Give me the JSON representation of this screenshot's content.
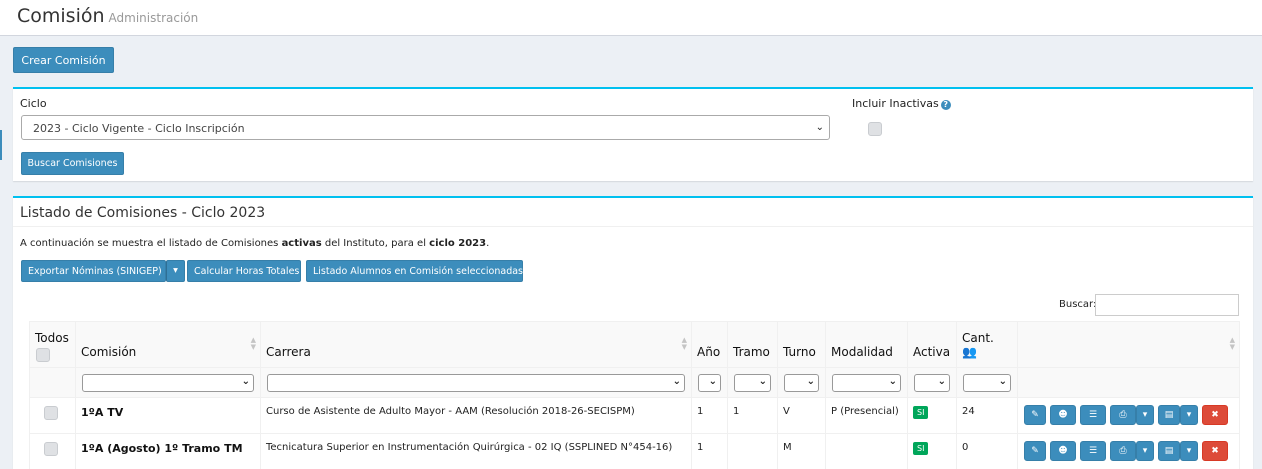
{
  "header": {
    "title": "Comisión",
    "subtitle": "Administración"
  },
  "create_button": "Crear Comisión",
  "filter": {
    "ciclo_label": "Ciclo",
    "ciclo_value": "2023 - Ciclo Vigente - Ciclo Inscripción",
    "inactivas_label": "Incluir Inactivas",
    "help_glyph": "?",
    "buscar_button": "Buscar Comisiones"
  },
  "list": {
    "title": "Listado de Comisiones - Ciclo 2023",
    "intro_pre": "A continuación se muestra el listado de Comisiones ",
    "intro_bold1": "activas",
    "intro_mid": " del Instituto, para el ",
    "intro_bold2": "ciclo 2023",
    "intro_end": ".",
    "buttons": {
      "export": "Exportar Nóminas (SINIGEP)",
      "horas": "Calcular Horas Totales",
      "alumnos": "Listado Alumnos en Comisión seleccionadas"
    },
    "search_label": "Buscar:",
    "columns": {
      "todos": "Todos",
      "comision": "Comisión",
      "carrera": "Carrera",
      "anio": "Año",
      "tramo": "Tramo",
      "turno": "Turno",
      "modalidad": "Modalidad",
      "activa": "Activa",
      "cant": "Cant."
    },
    "rows": [
      {
        "comision": "1ºA TV",
        "carrera": "Curso de Asistente de Adulto Mayor - AAM (Resolución 2018-26-SECISPM)",
        "anio": "1",
        "tramo": "1",
        "turno": "V",
        "modalidad": "P (Presencial)",
        "activa": "SI",
        "cant": "24"
      },
      {
        "comision": "1ºA (Agosto) 1º Tramo TM",
        "carrera": "Tecnicatura Superior en Instrumentación Quirúrgica - 02 IQ (SSPLINED N°454-16)",
        "anio": "1",
        "tramo": "",
        "turno": "M",
        "modalidad": "",
        "activa": "SI",
        "cant": "0"
      }
    ]
  },
  "colors": {
    "primary": "#3c8dbc",
    "danger": "#dd4b39",
    "success": "#00a65a",
    "box_accent": "#00c0ef",
    "page_bg": "#ecf0f5"
  },
  "icons": [
    "help-icon",
    "users-icon",
    "chevron-down-icon",
    "sort-icon",
    "edit-icon",
    "group-icon",
    "list-icon",
    "print-icon",
    "caret-down-icon",
    "file-icon",
    "trash-icon"
  ]
}
